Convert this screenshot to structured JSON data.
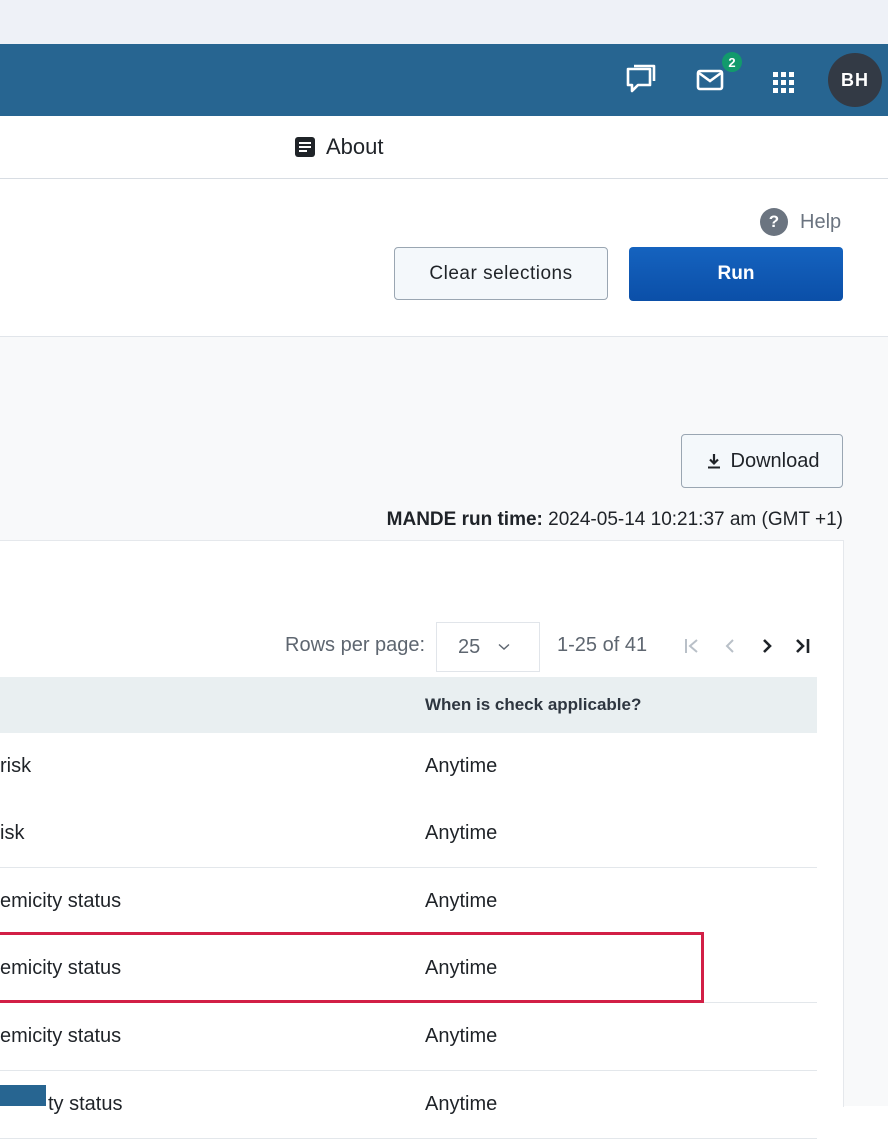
{
  "header": {
    "mail_badge": "2",
    "avatar_initials": "BH",
    "icons": [
      "chat-icon",
      "mail-icon",
      "apps-grid-icon"
    ]
  },
  "nav": {
    "about_label": "About"
  },
  "actions": {
    "help_label": "Help",
    "clear_label": "Clear selections",
    "run_label": "Run"
  },
  "results": {
    "download_label": "Download",
    "run_time_label": "MANDE run time:",
    "run_time_value": "2024-05-14 10:21:37 am (GMT +1)"
  },
  "pager": {
    "rows_per_page_label": "Rows per page:",
    "rows_per_page_value": "25",
    "range": "1-25 of 41"
  },
  "table": {
    "column_when": "When is check applicable?",
    "rows": [
      {
        "c1": "risk",
        "c2": "Anytime"
      },
      {
        "c1": "isk",
        "c2": "Anytime"
      },
      {
        "c1": "emicity status",
        "c2": "Anytime"
      },
      {
        "c1": "emicity status",
        "c2": "Anytime"
      },
      {
        "c1": "emicity status",
        "c2": "Anytime"
      },
      {
        "c1": "ty status",
        "c2": "Anytime"
      }
    ]
  },
  "colors": {
    "header_bg": "#276591",
    "run_button": "#0b4fa8",
    "highlight": "#d21f46",
    "badge": "#129a6c"
  }
}
